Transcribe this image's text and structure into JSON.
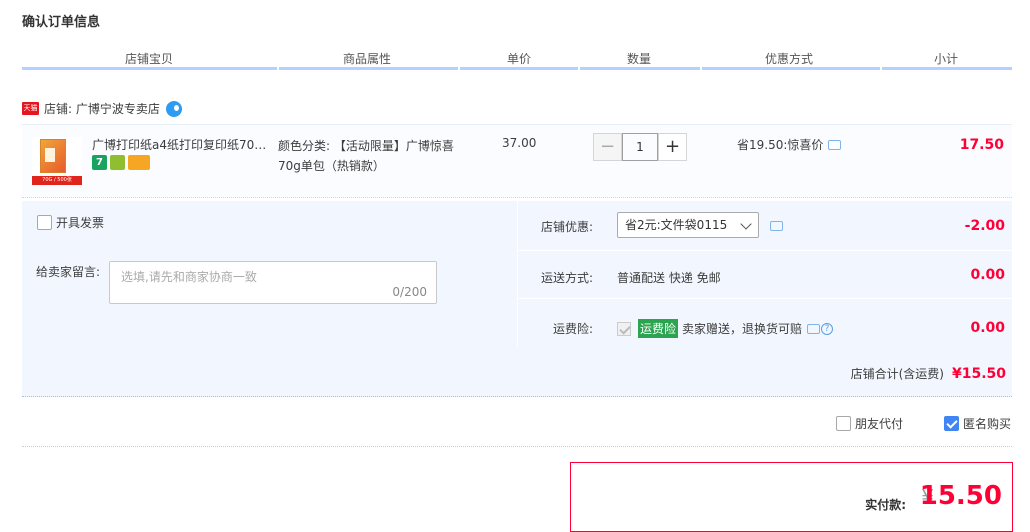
{
  "page_title": "确认订单信息",
  "columns": [
    "店铺宝贝",
    "商品属性",
    "单价",
    "数量",
    "优惠方式",
    "小计"
  ],
  "shop": {
    "badge": "天猫",
    "label": "店铺: 广博宁波专卖店"
  },
  "item": {
    "img_strip": "70G / 500张",
    "title": "广博打印纸a4纸打印复印纸70g...",
    "badges": [
      "7",
      "",
      ""
    ],
    "attr": "颜色分类: 【活动限量】广博惊喜70g单包（热销款）",
    "price": "37.00",
    "qty_minus": "−",
    "quantity": "1",
    "qty_plus": "+",
    "promo": "省19.50:惊喜价",
    "subtotal": "17.50"
  },
  "invoice_label": "开具发票",
  "message": {
    "label": "给卖家留言:",
    "placeholder": "选填,请先和商家协商一致",
    "count": "0/200"
  },
  "shop_coupon": {
    "label": "店铺优惠:",
    "value": "省2元:文件袋0115",
    "amount": "-2.00"
  },
  "shipping": {
    "label": "运送方式:",
    "value": "普通配送 快递 免邮",
    "amount": "0.00"
  },
  "insurance": {
    "label": "运费险:",
    "tag": "运费险",
    "text": "卖家赠送，退换货可赔",
    "amount": "0.00"
  },
  "shop_total": {
    "label": "店铺合计(含运费)",
    "amount": "¥15.50"
  },
  "options": {
    "friend_pay": "朋友代付",
    "anonymous": "匿名购买"
  },
  "payment": {
    "label": "实付款:",
    "currency": "¥",
    "total": "15.50"
  }
}
